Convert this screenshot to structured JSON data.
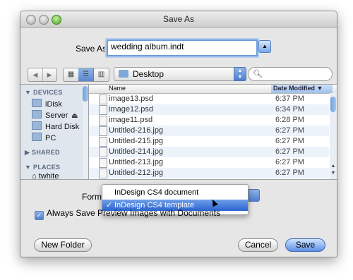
{
  "window": {
    "title": "Save As"
  },
  "save_as": {
    "label": "Save As:",
    "value": "wedding album.indt"
  },
  "location": {
    "current": "Desktop"
  },
  "sidebar": {
    "devices_heading": "DEVICES",
    "devices": [
      "iDisk",
      "Server",
      "Hard Disk",
      "PC"
    ],
    "shared_heading": "SHARED",
    "places_heading": "PLACES",
    "places": [
      "twhite"
    ]
  },
  "file_list": {
    "columns": {
      "name": "Name",
      "date": "Date Modified"
    },
    "rows": [
      {
        "name": "image13.psd",
        "date": "6:37 PM"
      },
      {
        "name": "image12.psd",
        "date": "6:34 PM"
      },
      {
        "name": "image11.psd",
        "date": "6:28 PM"
      },
      {
        "name": "Untitled-216.jpg",
        "date": "6:27 PM"
      },
      {
        "name": "Untitled-215.jpg",
        "date": "6:27 PM"
      },
      {
        "name": "Untitled-214.jpg",
        "date": "6:27 PM"
      },
      {
        "name": "Untitled-213.jpg",
        "date": "6:27 PM"
      },
      {
        "name": "Untitled-212.jpg",
        "date": "6:27 PM"
      }
    ]
  },
  "format": {
    "label": "Format",
    "options": [
      "InDesign CS4 document",
      "InDesign CS4 template"
    ],
    "selected": "InDesign CS4 template"
  },
  "preview_checkbox": {
    "label": "Always Save Preview Images with Documents",
    "checked": true
  },
  "buttons": {
    "new_folder": "New Folder",
    "cancel": "Cancel",
    "save": "Save"
  },
  "accent_color": "#4f7fcf"
}
